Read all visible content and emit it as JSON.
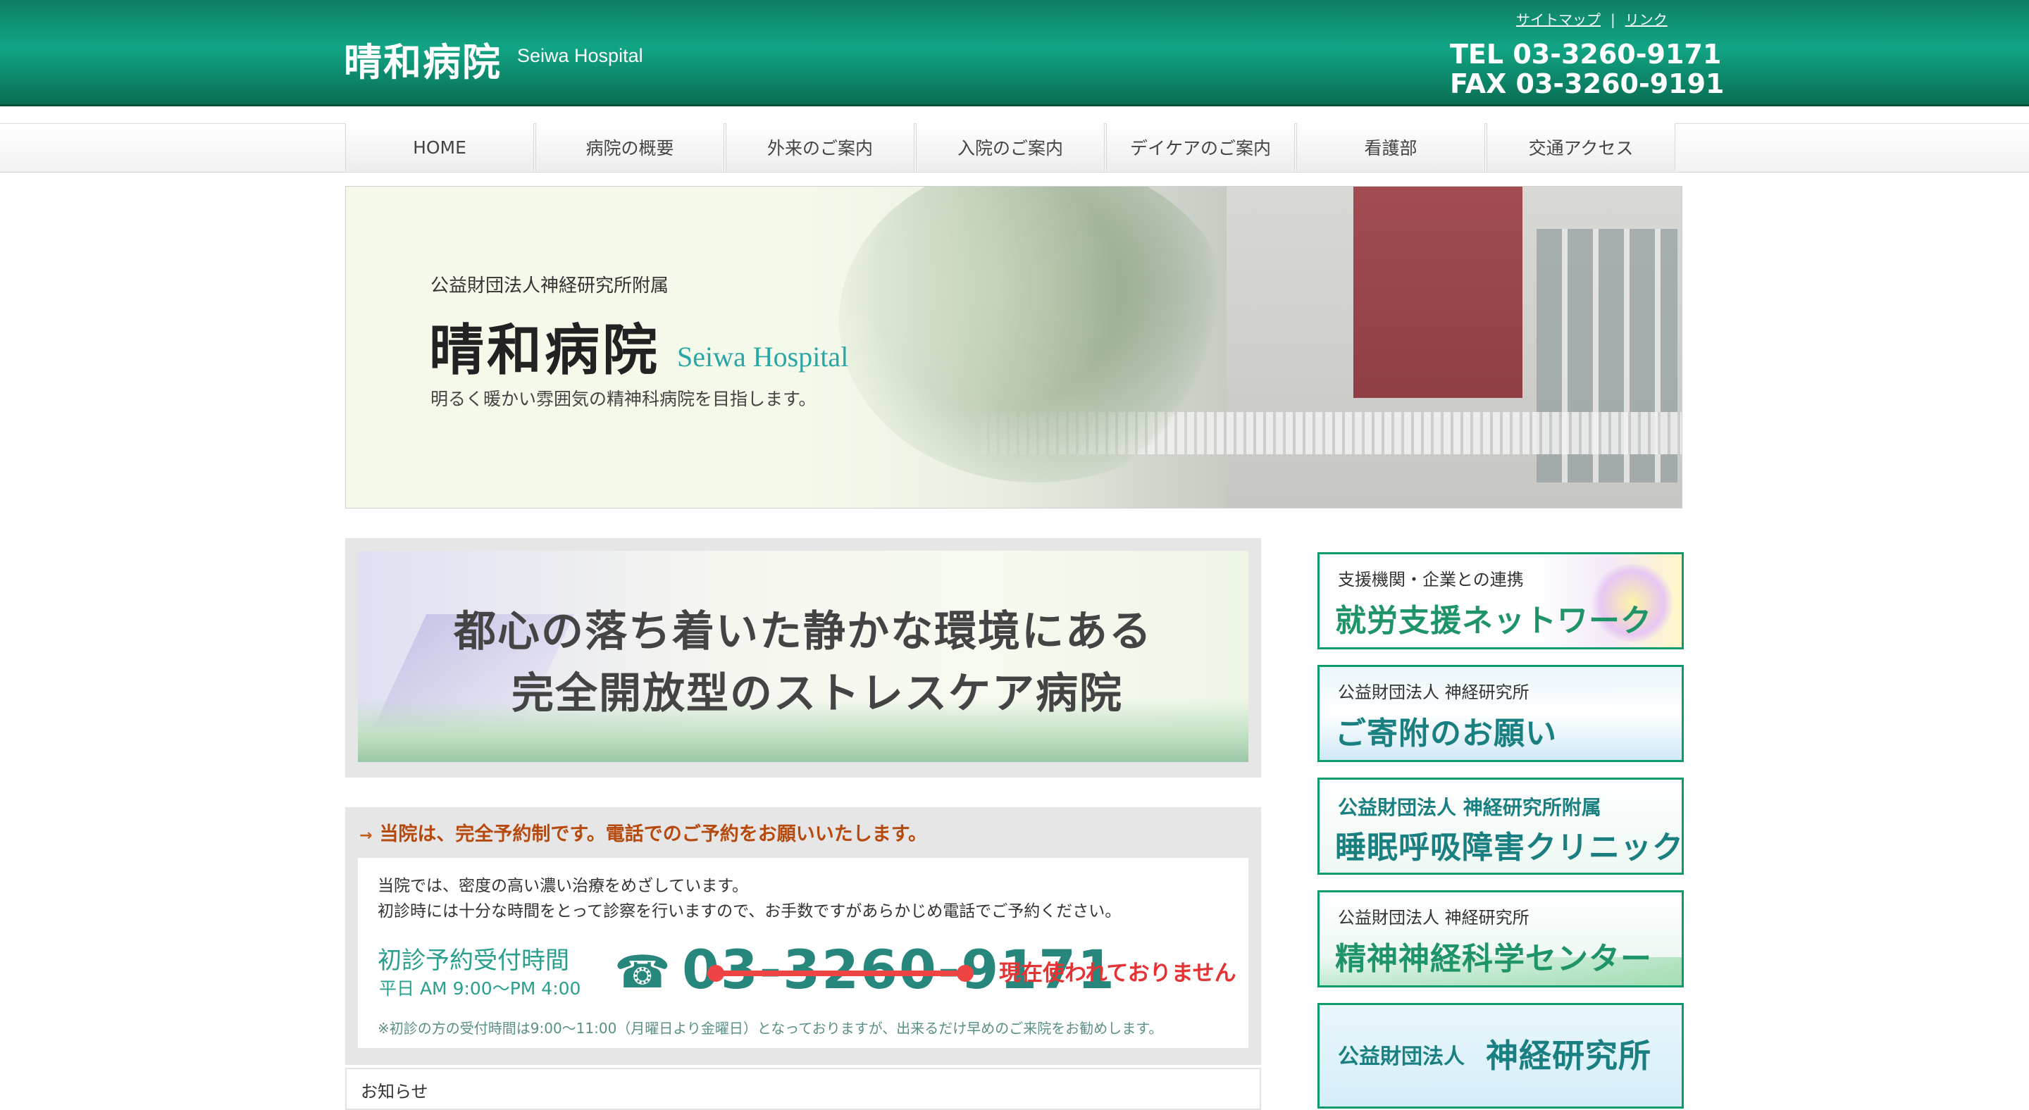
{
  "header": {
    "title": "晴和病院",
    "subtitle": "Seiwa Hospital",
    "links": [
      "サイトマップ",
      "リンク"
    ],
    "link_separator": "|",
    "tel": "TEL 03-3260-9171",
    "fax": "FAX 03-3260-9191",
    "brand_color": "#11a585"
  },
  "nav": {
    "items": [
      "HOME",
      "病院の概要",
      "外来のご案内",
      "入院のご案内",
      "デイケアのご案内",
      "看護部",
      "交通アクセス"
    ]
  },
  "hero": {
    "sub": "公益財団法人神経研究所附属",
    "title": "晴和病院",
    "title_en": "Seiwa Hospital",
    "tagline": "明るく暖かい雰囲気の精神科病院を目指します。"
  },
  "banner": {
    "line1": "都心の落ち着いた静かな環境にある",
    "line2": "完全開放型のストレスケア病院"
  },
  "reservation": {
    "heading": "当院は、完全予約制です。電話でのご予約をお願いいたします。",
    "text1": "当院では、密度の高い濃い治療をめざしています。",
    "text2": "初診時には十分な時間をとって診察を行いますので、お手数ですがあらかじめ電話でご予約ください。",
    "label": "初診予約受付時間",
    "hours": "平日 AM 9:00〜PM 4:00",
    "phone": "03-3260-9171",
    "notice": "現在使われておりません",
    "note": "※初診の方の受付時間は9:00〜11:00（月曜日より金曜日）となっておりますが、出来るだけ早めのご来院をお勧めします。",
    "notice_color": "#e53333"
  },
  "news": {
    "title": "お知らせ"
  },
  "sidebar": [
    {
      "small": "支援機関・企業との連携",
      "big": "就労支援ネットワーク",
      "big_color": "#1f9468"
    },
    {
      "small": "公益財団法人 神経研究所",
      "big": "ご寄附のお願い",
      "big_color": "#1a7f80"
    },
    {
      "small": "公益財団法人 神経研究所附属",
      "big": "睡眠呼吸障害クリニック",
      "big_color": "#1a7f80"
    },
    {
      "small": "公益財団法人 神経研究所",
      "big": "精神神経科学センター",
      "big_color": "#1f9468"
    },
    {
      "small": "公益財団法人",
      "big": "神経研究所",
      "big_color": "#1a7f80"
    }
  ]
}
